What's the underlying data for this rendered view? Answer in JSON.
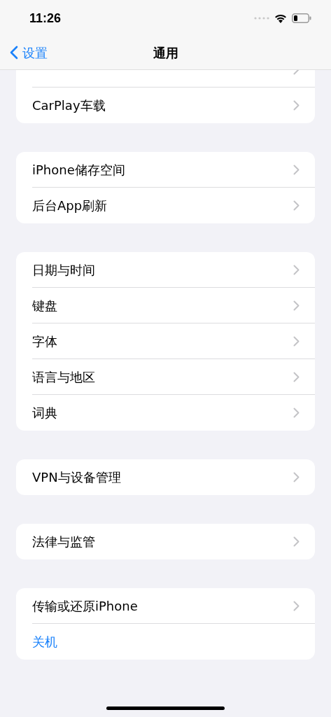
{
  "status_bar": {
    "time": "11:26"
  },
  "nav_bar": {
    "back": "设置",
    "title": "通用"
  },
  "groups": [
    {
      "items": [
        {
          "kind": "nav"
        },
        {
          "label": "CarPlay车载",
          "kind": "nav"
        }
      ]
    },
    {
      "items": [
        {
          "label": "iPhone储存空间",
          "kind": "nav"
        },
        {
          "label": "后台App刷新",
          "kind": "nav"
        }
      ]
    },
    {
      "items": [
        {
          "label": "日期与时间",
          "kind": "nav"
        },
        {
          "label": "键盘",
          "kind": "nav"
        },
        {
          "label": "字体",
          "kind": "nav"
        },
        {
          "label": "语言与地区",
          "kind": "nav"
        },
        {
          "label": "词典",
          "kind": "nav"
        }
      ]
    },
    {
      "items": [
        {
          "label": "VPN与设备管理",
          "kind": "nav"
        }
      ]
    },
    {
      "items": [
        {
          "label": "法律与监管",
          "kind": "nav"
        }
      ]
    },
    {
      "items": [
        {
          "label": "传输或还原iPhone",
          "kind": "nav"
        },
        {
          "label": "关机",
          "kind": "action"
        }
      ]
    }
  ]
}
